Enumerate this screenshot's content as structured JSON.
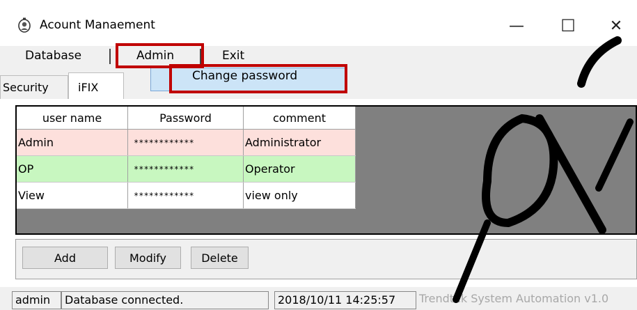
{
  "window": {
    "title": "Acount Manaement",
    "minimize_glyph": "—",
    "maximize_glyph": "☐",
    "close_glyph": "✕"
  },
  "menubar": {
    "items": [
      "Database",
      "Admin",
      "Exit"
    ]
  },
  "dropdown": {
    "items": [
      "Change password"
    ]
  },
  "tabs": [
    "Security",
    "iFIX"
  ],
  "grid": {
    "columns": [
      "user name",
      "Password",
      "comment"
    ],
    "rows": [
      {
        "user": "Admin",
        "password": "************",
        "comment": "Administrator",
        "color": "#fde0dc"
      },
      {
        "user": "OP",
        "password": "************",
        "comment": "Operator",
        "color": "#c8f7c0"
      },
      {
        "user": "View",
        "password": "************",
        "comment": "view only",
        "color": "#ffffff"
      }
    ]
  },
  "buttons": {
    "add": "Add",
    "modify": "Modify",
    "delete": "Delete"
  },
  "statusbar": {
    "user": "admin",
    "status": "Database connected.",
    "datetime": "2018/10/11 14:25:57",
    "company": "Trendtek System Automation v1.0"
  },
  "colors": {
    "highlight": "#c00000",
    "menu_hover": "#cce4f7"
  },
  "icons": [
    "app-icon",
    "minimize-icon",
    "maximize-icon",
    "close-icon"
  ]
}
